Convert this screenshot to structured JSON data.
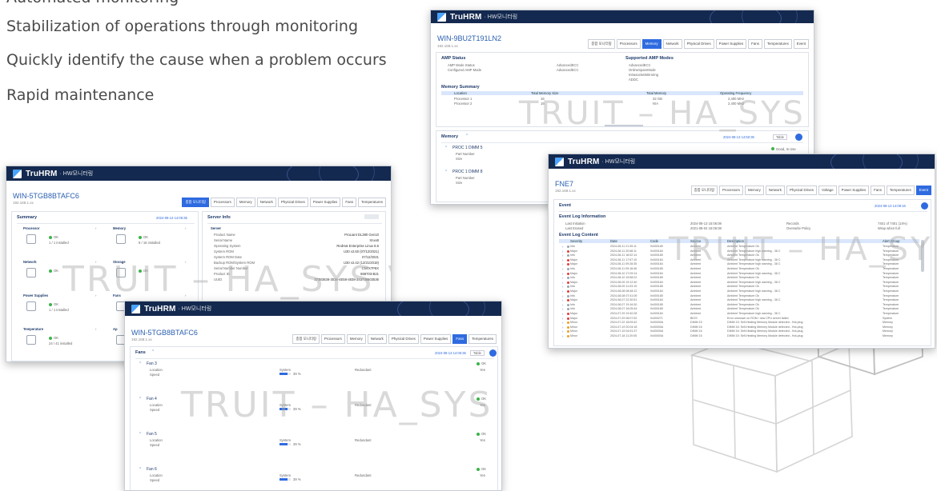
{
  "bullets": [
    "Automated monitoring",
    "Stabilization of operations through monitoring",
    "Quickly identify the cause when a problem occurs",
    "Rapid maintenance"
  ],
  "app": {
    "brand": "TruHRM",
    "brand_sub": "· HW모니터링",
    "watermark": "TRUIT – HA_SYS V5"
  },
  "win_memory": {
    "host": "WIN-9BU2T191LN2",
    "ip": "192.168.1.xx",
    "tabs": [
      "종합 모니터링",
      "Processors",
      "Memory",
      "Network",
      "Physical Drives",
      "Power Supplies",
      "Fans",
      "Temperatures",
      "Event"
    ],
    "amp_status": "AMP Status",
    "amp_rows": [
      [
        "AMP Mode Status",
        "AdvancedECC"
      ],
      [
        "Configured AMP Mode",
        "AdvancedECC"
      ]
    ],
    "supported_title": "Supported AMP Modes",
    "supported": [
      "AdvancedECC",
      "OnlineSpareMode",
      "IntrasocketMirroring",
      "ADDC"
    ],
    "summary_title": "Memory Summary",
    "summary_headers": [
      "Location",
      "Total Memory Size",
      "",
      "Total Memory",
      "Operating Frequency"
    ],
    "summary_rows": [
      [
        "Processor 1",
        "16",
        "",
        "32 GB",
        "2,400 MHz"
      ],
      [
        "Processor 2",
        "16",
        "",
        "N/A",
        "2,400 MHz"
      ]
    ],
    "memory_title": "Memory",
    "proc1": "PROC 1 DIMM 5",
    "proc2": "PROC 1 DIMM 8",
    "part": "Part Number",
    "size": "Size",
    "status": "Good, In Use",
    "time": "2024-08-13 14:50:35",
    "table_btn": "Table"
  },
  "win_summary": {
    "host": "WIN-5TGB8BTAFC6",
    "ip": "192.168.1.xx",
    "time": "2024-08-13 14:06:35",
    "tabs": [
      "종합 모니터링",
      "Processors",
      "Memory",
      "Network",
      "Physical Drives",
      "Power Supplies",
      "Fans",
      "Temperatures"
    ],
    "summary_title": "Summary",
    "server_title": "Server Info",
    "cards": [
      {
        "name": "Processor",
        "status": "OK",
        "sub": "1 / 1 installed"
      },
      {
        "name": "Memory",
        "status": "OK",
        "sub": "8 / 16 installed"
      },
      {
        "name": "Network",
        "status": "OK",
        "sub": ""
      },
      {
        "name": "Storage",
        "status": "OK",
        "sub": ""
      },
      {
        "name": "Power Supplies",
        "status": "OK",
        "sub": "1 / 1 installed"
      },
      {
        "name": "Fans",
        "status": "OK",
        "sub": ""
      },
      {
        "name": "Temperature",
        "status": "OK",
        "sub": "24 / 41 installed"
      },
      {
        "name": "Ap",
        "status": "",
        "sub": ""
      }
    ],
    "server_section": "Server",
    "server_rows": [
      [
        "Product Name",
        "ProLiant DL380 Gen10"
      ],
      [
        "Serial Name",
        "Xnxx8"
      ],
      [
        "Operating System",
        "RedHat Enterprise Linux 8.6"
      ],
      [
        "System ROM",
        "U30 v2.50 (07/12/2021)"
      ],
      [
        "System ROM Date",
        "07/12/2021"
      ],
      [
        "Backup ROM/System ROM",
        "U30 v2.42 (12/21/2018)"
      ],
      [
        "Serial Number Number",
        "CN7X7P6X"
      ],
      [
        "Product ID",
        "868703-B21"
      ],
      [
        "UUID",
        "37383638-3034-4E58-4838-343738503536"
      ]
    ]
  },
  "win_fans": {
    "host": "WIN-5TGB8BTAFC6",
    "ip": "192.168.1.xx",
    "tabs": [
      "종합 모니터링",
      "Processors",
      "Memory",
      "Network",
      "Physical Drives",
      "Power Supplies",
      "Fans",
      "Temperatures"
    ],
    "title": "Fans",
    "time": "2024-08-13 14:06:35",
    "table_btn": "Table",
    "fans": [
      {
        "name": "Fan 3",
        "status": "OK",
        "redundant": "Yes",
        "speed": "39 %"
      },
      {
        "name": "Fan 4",
        "status": "OK",
        "redundant": "Yes",
        "speed": "39 %"
      },
      {
        "name": "Fan 5",
        "status": "OK",
        "redundant": "Yes",
        "speed": "39 %"
      },
      {
        "name": "Fan 6",
        "status": "OK",
        "redundant": "Yes",
        "speed": "39 %"
      }
    ],
    "loc": "Location",
    "speed": "Speed",
    "system": "System",
    "redund": "Redundant"
  },
  "win_event": {
    "host": "FNE7",
    "ip": "192.168.1.xx",
    "tabs": [
      "종합 모니터링",
      "Processors",
      "Memory",
      "Network",
      "Physical Drives",
      "Voltage",
      "Power Supplies",
      "Fans",
      "Temperatures",
      "Event"
    ],
    "title": "Event",
    "time": "2024-08-13 14:09:16",
    "log_info": "Event Log Information",
    "info_rows": [
      [
        "Last Initiation",
        "2024-08-13 15:06:08",
        "Records",
        "7401 of 7401 (14%)"
      ],
      [
        "Last Erased",
        "2021-08-04 15:06:08",
        "Overwrite Policy",
        "Wrap when full"
      ]
    ],
    "log_content": "Event Log Content",
    "headers": [
      "Severity",
      "Date",
      "Code",
      "Source",
      "Description",
      "Alert Group"
    ],
    "rows": [
      [
        "Info",
        "2024-08-11 21:39:11",
        "0x000185",
        "Ambient",
        "Ambient Temperature Ok",
        "Temperature"
      ],
      [
        "Major",
        "2024-08-11 20:58:11",
        "0x000184",
        "Ambient",
        "Ambient Temperature high warning - 38 C",
        "Temperature"
      ],
      [
        "Info",
        "2024-08-11 18:02:14",
        "0x000185",
        "Ambient",
        "Ambient Temperature Ok",
        "Temperature"
      ],
      [
        "Major",
        "2024-08-11 17:57:10",
        "0x000184",
        "Ambient",
        "Ambient Temperature high warning - 38 C",
        "Temperature"
      ],
      [
        "Major",
        "2024-08-11 09:28:35",
        "0x000184",
        "Ambient",
        "Ambient Temperature high warning - 38 C",
        "Temperature"
      ],
      [
        "Info",
        "2024-08-11 09:18:46",
        "0x000185",
        "Ambient",
        "Ambient Temperature Ok",
        "Temperature"
      ],
      [
        "Major",
        "2024-08-10 17:09:14",
        "0x000184",
        "Ambient",
        "Ambient Temperature high warning - 38 C",
        "Temperature"
      ],
      [
        "Info",
        "2024-08-10 15:58:22",
        "0x000185",
        "Ambient",
        "Ambient Temperature Ok",
        "Temperature"
      ],
      [
        "Major",
        "2024-08-09 19:12:40",
        "0x000184",
        "Ambient",
        "Ambient Temperature high warning - 38 C",
        "Temperature"
      ],
      [
        "Info",
        "2024-08-09 11:03:19",
        "0x000185",
        "Ambient",
        "Ambient Temperature Ok",
        "Temperature"
      ],
      [
        "Major",
        "2024-08-08 08:48:12",
        "0x000184",
        "Ambient",
        "Ambient Temperature high warning - 38 C",
        "Temperature"
      ],
      [
        "Info",
        "2024-08-08 07:41:05",
        "0x000185",
        "Ambient",
        "Ambient Temperature Ok",
        "Temperature"
      ],
      [
        "Major",
        "2024-08-07 22:30:51",
        "0x000184",
        "Ambient",
        "Ambient Temperature high warning - 38 C",
        "Temperature"
      ],
      [
        "Info",
        "2024-08-07 19:16:30",
        "0x000185",
        "Ambient",
        "Ambient Temperature Ok",
        "Temperature"
      ],
      [
        "Info",
        "2024-08-07 16:05:44",
        "0x000185",
        "Ambient",
        "Ambient Temperature Ok",
        "Temperature"
      ],
      [
        "Major",
        "2024-07-29 19:40:28",
        "0x000184",
        "Ambient",
        "Ambient Temperature high warning - 38 C",
        "Temperature"
      ],
      [
        "Major",
        "2024-07-29 06:07:52",
        "0x000271",
        "BIOS",
        "Error unknown on ROM / new CPU server failed",
        "System"
      ],
      [
        "Minor",
        "2024-07-22 18:09:42",
        "0x00000A",
        "DIMM 15",
        "DIMM 15: Self-Healing Memory Module detected - Hot-plug",
        "Memory"
      ],
      [
        "Minor",
        "2024-07-19 20:04:18",
        "0x00000A",
        "DIMM 16",
        "DIMM 16: Self-Healing Memory Module detected - Hot-plug",
        "Memory"
      ],
      [
        "Minor",
        "2024-07-19 04:51:37",
        "0x00000A",
        "DIMM 16",
        "DIMM 16: Self-Healing Memory Module detected - Hot-plug",
        "Memory"
      ],
      [
        "Minor",
        "2024-07-18 11:20:05",
        "0x00000A",
        "DIMM 15",
        "DIMM 15: Self-Healing Memory Module detected - Hot-plug",
        "Memory"
      ]
    ]
  },
  "colors": {
    "topbar": "#14294f",
    "accent": "#2f6be0",
    "ok": "#3cb44b",
    "major": "#e23b3b",
    "minor": "#f0a020"
  }
}
